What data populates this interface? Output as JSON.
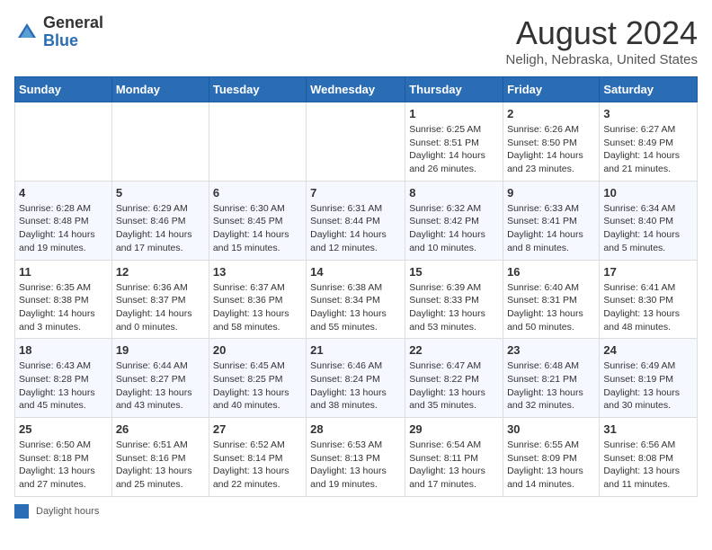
{
  "header": {
    "logo_general": "General",
    "logo_blue": "Blue",
    "month_year": "August 2024",
    "location": "Neligh, Nebraska, United States"
  },
  "days_of_week": [
    "Sunday",
    "Monday",
    "Tuesday",
    "Wednesday",
    "Thursday",
    "Friday",
    "Saturday"
  ],
  "weeks": [
    [
      {
        "day": "",
        "info": ""
      },
      {
        "day": "",
        "info": ""
      },
      {
        "day": "",
        "info": ""
      },
      {
        "day": "",
        "info": ""
      },
      {
        "day": "1",
        "info": "Sunrise: 6:25 AM\nSunset: 8:51 PM\nDaylight: 14 hours and 26 minutes."
      },
      {
        "day": "2",
        "info": "Sunrise: 6:26 AM\nSunset: 8:50 PM\nDaylight: 14 hours and 23 minutes."
      },
      {
        "day": "3",
        "info": "Sunrise: 6:27 AM\nSunset: 8:49 PM\nDaylight: 14 hours and 21 minutes."
      }
    ],
    [
      {
        "day": "4",
        "info": "Sunrise: 6:28 AM\nSunset: 8:48 PM\nDaylight: 14 hours and 19 minutes."
      },
      {
        "day": "5",
        "info": "Sunrise: 6:29 AM\nSunset: 8:46 PM\nDaylight: 14 hours and 17 minutes."
      },
      {
        "day": "6",
        "info": "Sunrise: 6:30 AM\nSunset: 8:45 PM\nDaylight: 14 hours and 15 minutes."
      },
      {
        "day": "7",
        "info": "Sunrise: 6:31 AM\nSunset: 8:44 PM\nDaylight: 14 hours and 12 minutes."
      },
      {
        "day": "8",
        "info": "Sunrise: 6:32 AM\nSunset: 8:42 PM\nDaylight: 14 hours and 10 minutes."
      },
      {
        "day": "9",
        "info": "Sunrise: 6:33 AM\nSunset: 8:41 PM\nDaylight: 14 hours and 8 minutes."
      },
      {
        "day": "10",
        "info": "Sunrise: 6:34 AM\nSunset: 8:40 PM\nDaylight: 14 hours and 5 minutes."
      }
    ],
    [
      {
        "day": "11",
        "info": "Sunrise: 6:35 AM\nSunset: 8:38 PM\nDaylight: 14 hours and 3 minutes."
      },
      {
        "day": "12",
        "info": "Sunrise: 6:36 AM\nSunset: 8:37 PM\nDaylight: 14 hours and 0 minutes."
      },
      {
        "day": "13",
        "info": "Sunrise: 6:37 AM\nSunset: 8:36 PM\nDaylight: 13 hours and 58 minutes."
      },
      {
        "day": "14",
        "info": "Sunrise: 6:38 AM\nSunset: 8:34 PM\nDaylight: 13 hours and 55 minutes."
      },
      {
        "day": "15",
        "info": "Sunrise: 6:39 AM\nSunset: 8:33 PM\nDaylight: 13 hours and 53 minutes."
      },
      {
        "day": "16",
        "info": "Sunrise: 6:40 AM\nSunset: 8:31 PM\nDaylight: 13 hours and 50 minutes."
      },
      {
        "day": "17",
        "info": "Sunrise: 6:41 AM\nSunset: 8:30 PM\nDaylight: 13 hours and 48 minutes."
      }
    ],
    [
      {
        "day": "18",
        "info": "Sunrise: 6:43 AM\nSunset: 8:28 PM\nDaylight: 13 hours and 45 minutes."
      },
      {
        "day": "19",
        "info": "Sunrise: 6:44 AM\nSunset: 8:27 PM\nDaylight: 13 hours and 43 minutes."
      },
      {
        "day": "20",
        "info": "Sunrise: 6:45 AM\nSunset: 8:25 PM\nDaylight: 13 hours and 40 minutes."
      },
      {
        "day": "21",
        "info": "Sunrise: 6:46 AM\nSunset: 8:24 PM\nDaylight: 13 hours and 38 minutes."
      },
      {
        "day": "22",
        "info": "Sunrise: 6:47 AM\nSunset: 8:22 PM\nDaylight: 13 hours and 35 minutes."
      },
      {
        "day": "23",
        "info": "Sunrise: 6:48 AM\nSunset: 8:21 PM\nDaylight: 13 hours and 32 minutes."
      },
      {
        "day": "24",
        "info": "Sunrise: 6:49 AM\nSunset: 8:19 PM\nDaylight: 13 hours and 30 minutes."
      }
    ],
    [
      {
        "day": "25",
        "info": "Sunrise: 6:50 AM\nSunset: 8:18 PM\nDaylight: 13 hours and 27 minutes."
      },
      {
        "day": "26",
        "info": "Sunrise: 6:51 AM\nSunset: 8:16 PM\nDaylight: 13 hours and 25 minutes."
      },
      {
        "day": "27",
        "info": "Sunrise: 6:52 AM\nSunset: 8:14 PM\nDaylight: 13 hours and 22 minutes."
      },
      {
        "day": "28",
        "info": "Sunrise: 6:53 AM\nSunset: 8:13 PM\nDaylight: 13 hours and 19 minutes."
      },
      {
        "day": "29",
        "info": "Sunrise: 6:54 AM\nSunset: 8:11 PM\nDaylight: 13 hours and 17 minutes."
      },
      {
        "day": "30",
        "info": "Sunrise: 6:55 AM\nSunset: 8:09 PM\nDaylight: 13 hours and 14 minutes."
      },
      {
        "day": "31",
        "info": "Sunrise: 6:56 AM\nSunset: 8:08 PM\nDaylight: 13 hours and 11 minutes."
      }
    ]
  ],
  "legend": {
    "box_label": "Daylight hours"
  }
}
